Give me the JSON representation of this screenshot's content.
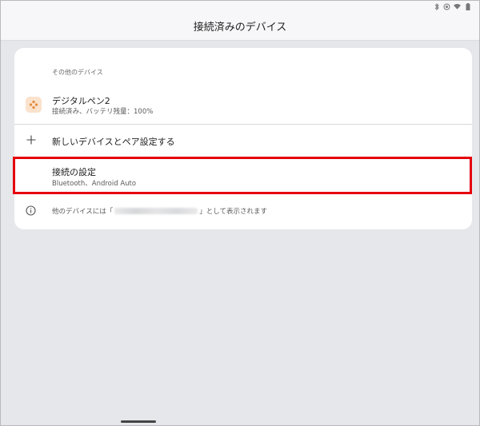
{
  "status_bar": {
    "icons": [
      "bluetooth-icon",
      "hotspot-icon",
      "wifi-icon",
      "battery-icon"
    ]
  },
  "app_bar": {
    "title": "接続済みのデバイス"
  },
  "section": {
    "header": "その他のデバイス"
  },
  "device": {
    "name": "デジタルペン2",
    "status": "接続済み、バッテリ残量：100%",
    "icon": "gamepad-icon",
    "icon_bg": "#fbe2cc",
    "icon_color": "#e28a3a"
  },
  "pair": {
    "label": "新しいデバイスとペア設定する",
    "icon": "plus-icon"
  },
  "connection_settings": {
    "label": "接続の設定",
    "sub": "Bluetooth、Android Auto",
    "highlight_color": "#e5000d"
  },
  "info": {
    "icon": "info-icon",
    "prefix": "他のデバイスには「",
    "suffix": "」として表示されます"
  }
}
